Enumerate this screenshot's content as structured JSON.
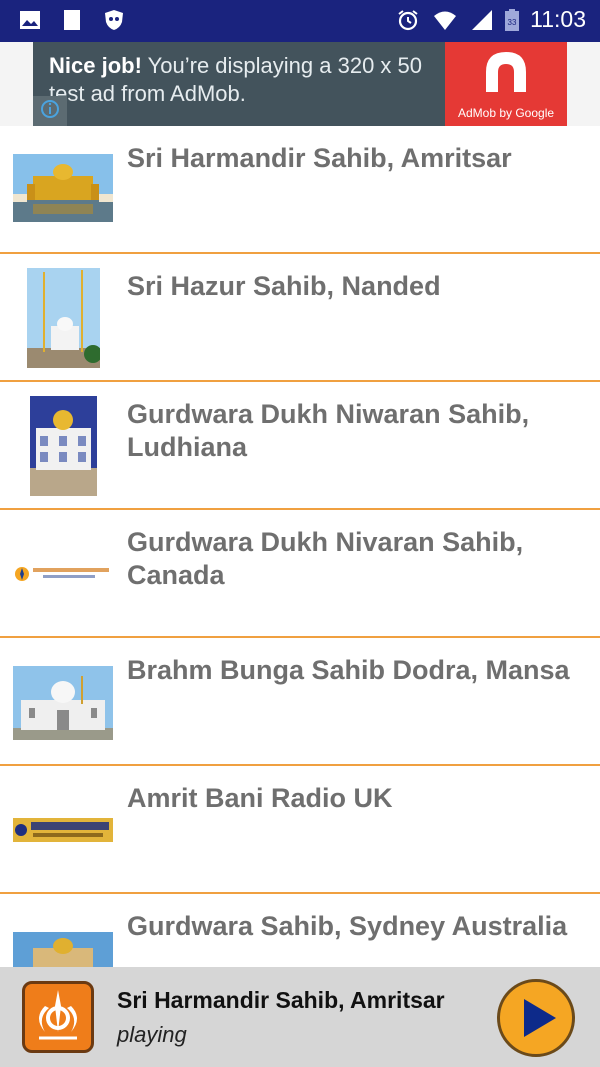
{
  "status_bar": {
    "time": "11:03",
    "battery": "33",
    "icons": [
      "gallery-icon",
      "document-icon",
      "shield-app-icon",
      "alarm-icon",
      "wifi-icon",
      "signal-icon",
      "battery-icon"
    ]
  },
  "ad": {
    "bold": "Nice job!",
    "text": " You’re displaying a 320 x 50 test ad from AdMob.",
    "brand": "AdMob by Google"
  },
  "stations": [
    {
      "title": "Sri Harmandir Sahib, Amritsar"
    },
    {
      "title": "Sri Hazur Sahib, Nanded"
    },
    {
      "title": "Gurdwara Dukh Niwaran Sahib, Ludhiana"
    },
    {
      "title": "Gurdwara Dukh Nivaran Sahib, Canada"
    },
    {
      "title": "Brahm Bunga Sahib Dodra, Mansa"
    },
    {
      "title": "Amrit Bani Radio UK"
    },
    {
      "title": "Gurdwara Sahib, Sydney Australia"
    }
  ],
  "player": {
    "title": "Sri Harmandir Sahib, Amritsar",
    "status": "playing"
  },
  "colors": {
    "status_bar": "#1a237e",
    "divider": "#f0a040",
    "accent": "#f5a623",
    "title_text": "#6f6f6f"
  }
}
